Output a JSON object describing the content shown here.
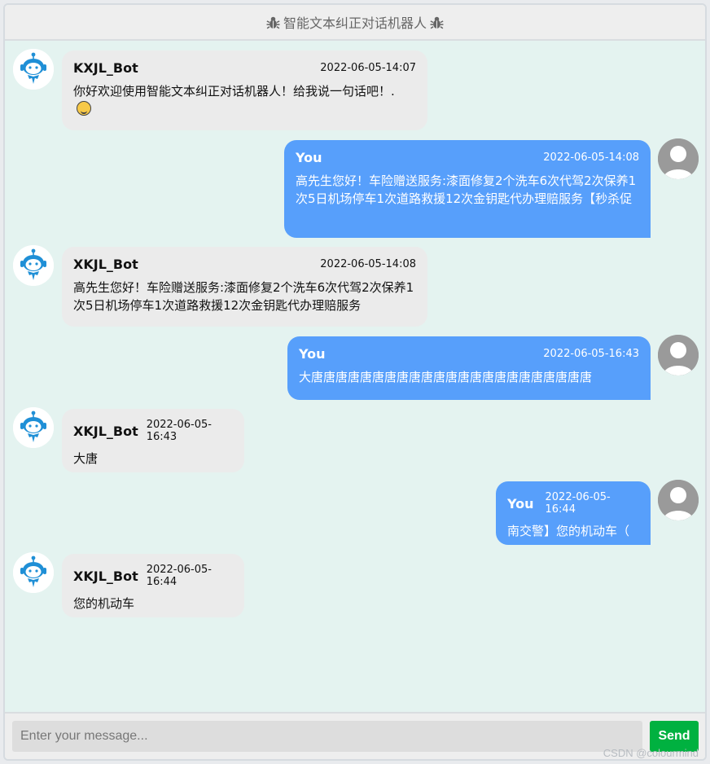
{
  "header": {
    "title": "智能文本纠正对话机器人",
    "icon": "bug-icon"
  },
  "messages": [
    {
      "side": "left",
      "name": "KXJL_Bot",
      "time": "2022-06-05-14:07",
      "text": "你好欢迎使用智能文本纠正对话机器人！给我说一句话吧！.",
      "emoji": "grin-emoji"
    },
    {
      "side": "right",
      "name": "You",
      "time": "2022-06-05-14:08",
      "text": "高先生您好！车险赠送服务:漆面修复2个洗车6次代驾2次保养1次5日机场停车1次道路救援12次金钥匙代办理赔服务【秒杀促"
    },
    {
      "side": "left",
      "name": "XKJL_Bot",
      "time": "2022-06-05-14:08",
      "text": "高先生您好！车险赠送服务:漆面修复2个洗车6次代驾2次保养1次5日机场停车1次道路救援12次金钥匙代办理赔服务"
    },
    {
      "side": "right",
      "name": "You",
      "time": "2022-06-05-16:43",
      "text": "大唐唐唐唐唐唐唐唐唐唐唐唐唐唐唐唐唐唐唐唐唐唐唐"
    },
    {
      "side": "left",
      "name": "XKJL_Bot",
      "time": "2022-06-05-16:43",
      "text": "大唐"
    },
    {
      "side": "right",
      "name": "You",
      "time": "2022-06-05-16:44",
      "text": "南交警】您的机动车（"
    },
    {
      "side": "left",
      "name": "XKJL_Bot",
      "time": "2022-06-05-16:44",
      "text": "您的机动车"
    }
  ],
  "input": {
    "placeholder": "Enter your message...",
    "value": ""
  },
  "send_label": "Send",
  "watermark": "CSDN @colourmind",
  "colors": {
    "bot_bubble": "#ebebeb",
    "user_bubble": "#579ffb",
    "send": "#00b140",
    "chat_bg": "#e4f3f0"
  }
}
